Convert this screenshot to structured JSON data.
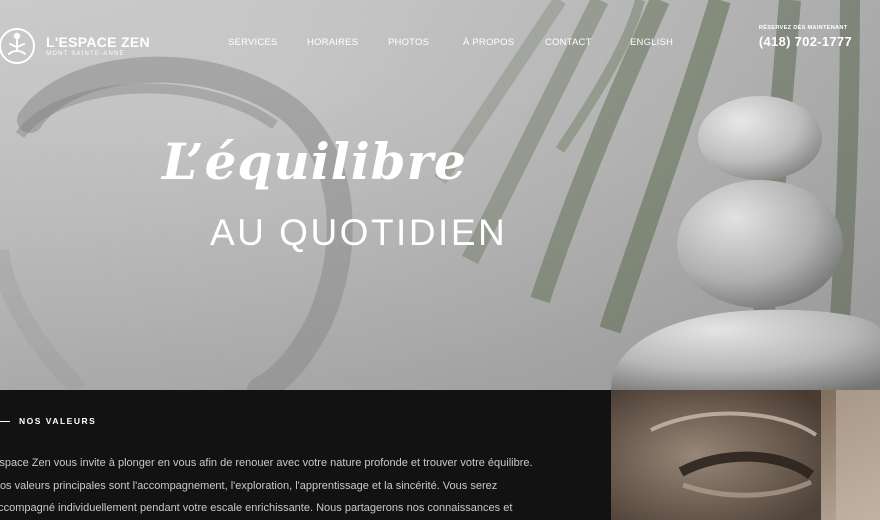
{
  "brand": {
    "name": "L'ESPACE ZEN",
    "tagline": "MONT SAINTE-ANNE"
  },
  "nav": {
    "items": [
      "SERVICES",
      "HORAIRES",
      "PHOTOS",
      "À PROPOS",
      "CONTACT",
      "ENGLISH"
    ]
  },
  "reservation": {
    "label": "RÉSERVEZ DÈS MAINTENANT",
    "phone": "(418) 702-1777"
  },
  "hero": {
    "script_title": "L’équilibre",
    "subtitle": "AU QUOTIDIEN"
  },
  "values": {
    "title": "NOS VALEURS",
    "lines": [
      "Espace Zen vous invite à plonger en vous afin de renouer avec votre nature profonde et trouver votre équilibre.",
      "Nos valeurs principales sont l'accompagnement, l'exploration, l'apprentissage et la sincérité. Vous serez",
      "accompagné individuellement pendant votre escale enrichissante. Nous partagerons nos connaissances et"
    ]
  },
  "colors": {
    "dark_bg": "#121212",
    "text_light": "#c9c9c9",
    "hero_gray": "#b3b3b3"
  },
  "icons": [
    "lotus-figure-icon"
  ]
}
